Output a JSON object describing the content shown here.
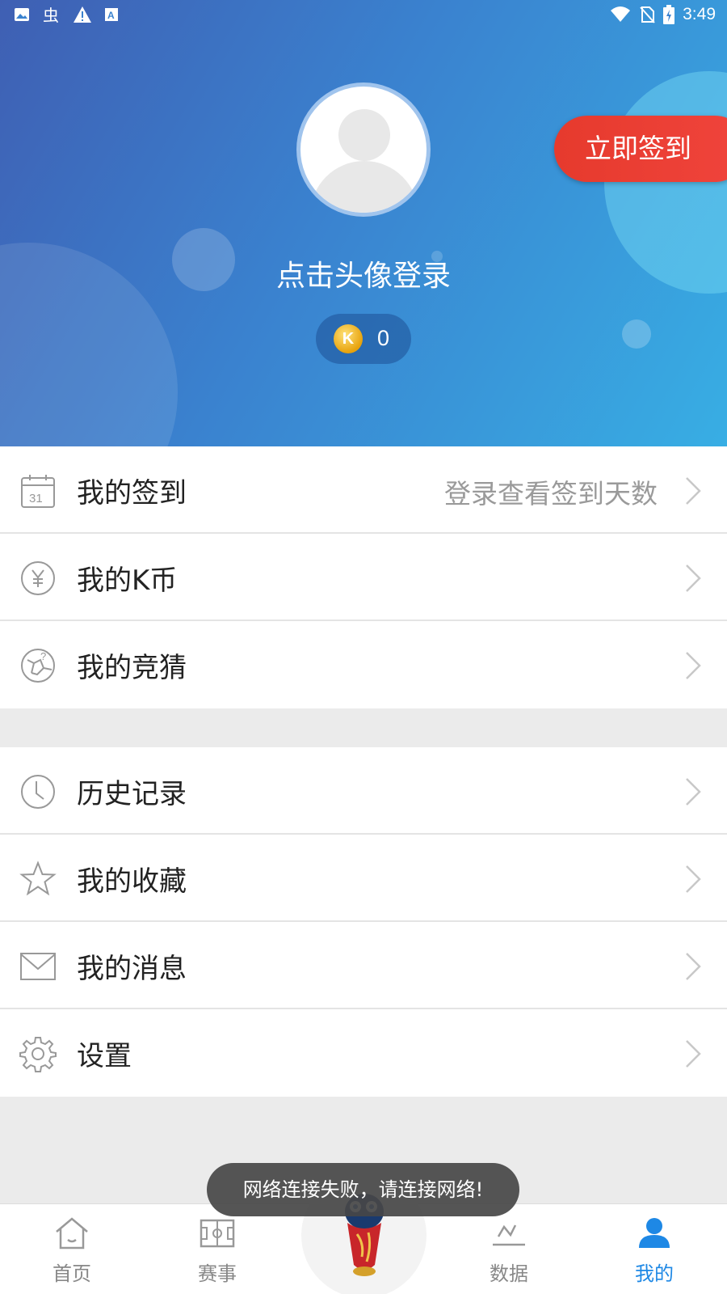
{
  "status_bar": {
    "time": "3:49",
    "left_icons": [
      "image-icon",
      "bug-icon",
      "warning-icon",
      "text-icon"
    ],
    "right_icons": [
      "wifi-icon",
      "no-sim-icon",
      "battery-charging-icon"
    ]
  },
  "profile": {
    "signin_button": "立即签到",
    "login_prompt": "点击头像登录",
    "coin_symbol": "K",
    "coin_count": "0"
  },
  "menu_group_1": [
    {
      "label": "我的签到",
      "value": "登录查看签到天数",
      "icon": "calendar-icon"
    },
    {
      "label": "我的K币",
      "value": "",
      "icon": "yen-coin-icon"
    },
    {
      "label": "我的竞猜",
      "value": "",
      "icon": "soccer-guess-icon"
    }
  ],
  "menu_group_2": [
    {
      "label": "历史记录",
      "icon": "clock-icon"
    },
    {
      "label": "我的收藏",
      "icon": "star-icon"
    },
    {
      "label": "我的消息",
      "icon": "mail-icon"
    },
    {
      "label": "设置",
      "icon": "gear-icon"
    }
  ],
  "calendar_day": "31",
  "toast": "网络连接失败，请连接网络!",
  "tabbar": {
    "home": "首页",
    "matches": "赛事",
    "data": "数据",
    "mine": "我的",
    "active": "mine",
    "center_icon": "world-cup-trophy-icon"
  },
  "colors": {
    "accent_blue": "#1e88e5",
    "signin_red": "#e63a2d",
    "header_gradient_start": "#3f5fb3",
    "header_gradient_end": "#38aee4"
  }
}
